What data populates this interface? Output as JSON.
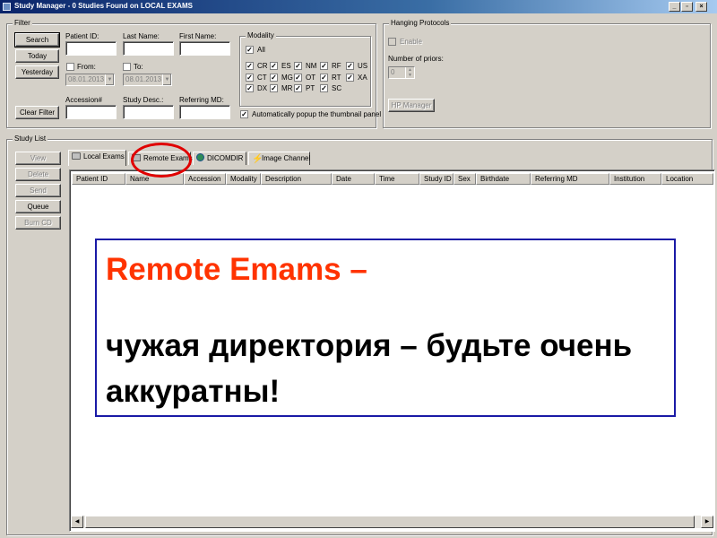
{
  "window": {
    "title": "Study Manager - 0 Studies Found on LOCAL EXAMS",
    "controls": [
      "minimize-icon",
      "restore-icon",
      "close-icon"
    ]
  },
  "filter": {
    "group_label": "Filter",
    "buttons": {
      "search": "Search",
      "today": "Today",
      "yesterday": "Yesterday",
      "clear": "Clear Filter"
    },
    "fields": {
      "patient_id": "Patient ID:",
      "last_name": "Last Name:",
      "first_name": "First Name:",
      "accession": "Accession#",
      "study_desc": "Study Desc.:",
      "referring_md": "Referring MD:"
    },
    "from_label": "From:",
    "to_label": "To:",
    "from_date": "08.01.2013",
    "to_date": "08.01.2013"
  },
  "modality": {
    "group_label": "Modality",
    "all_label": "All",
    "items": [
      "CR",
      "ES",
      "NM",
      "RF",
      "US",
      "CT",
      "MG",
      "OT",
      "RT",
      "XA",
      "DX",
      "MR",
      "PT",
      "SC"
    ],
    "auto_popup_label": "Automatically popup the thumbnail panel"
  },
  "hanging_protocols": {
    "group_label": "Hanging Protocols",
    "enable_label": "Enable",
    "priors_label": "Number of priors:",
    "priors_value": "0",
    "hp_manager": "HP Manager"
  },
  "study_list": {
    "group_label": "Study List",
    "side_buttons": {
      "view": "View",
      "delete": "Delete",
      "send": "Send",
      "queue": "Queue",
      "burn_cd": "Burn CD"
    },
    "tabs": [
      "Local Exams",
      "Remote Exams",
      "DICOMDIR",
      "Image Channel"
    ],
    "columns": [
      "Patient ID",
      "Name",
      "Accession",
      "Modality",
      "Description",
      "Date",
      "Time",
      "Study ID",
      "Sex",
      "Birthdate",
      "Referring MD",
      "Institution",
      "Location"
    ]
  },
  "callout": {
    "title": "Remote Emams –",
    "body": "чужая директория – будьте очень аккуратны!",
    "title_color": "#ff3300",
    "border_color": "#1a1aa6"
  },
  "annotation": {
    "highlight_color": "#e00000"
  }
}
